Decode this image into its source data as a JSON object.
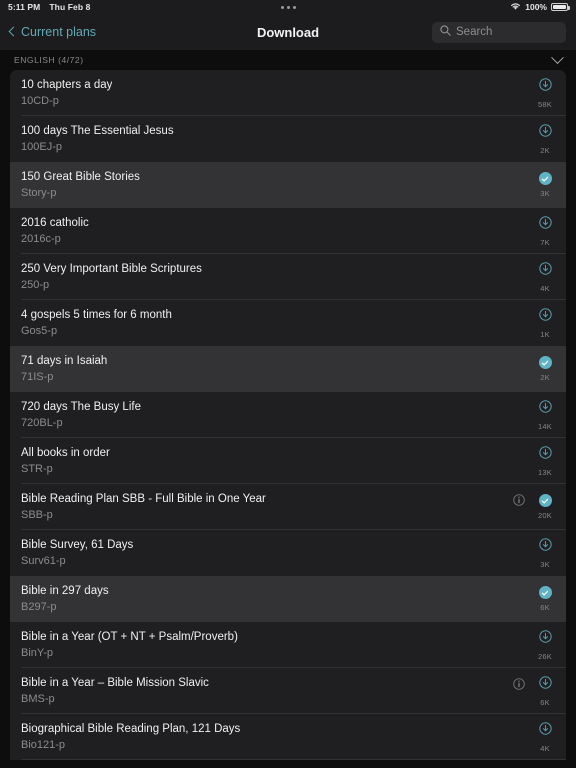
{
  "status_bar": {
    "time": "5:11 PM",
    "date": "Thu Feb 8",
    "menu_icon": "three-dots-icon",
    "wifi_icon": "wifi-icon",
    "battery_percent": "100%",
    "battery_icon": "battery-full-icon"
  },
  "nav_bar": {
    "back_icon": "chevron-left-icon",
    "back_label": "Current plans",
    "title": "Download",
    "search": {
      "icon": "search-icon",
      "value": "",
      "placeholder": "Search"
    }
  },
  "section": {
    "title": "ENGLISH (4/72)",
    "collapse_icon": "chevron-down-icon"
  },
  "colors": {
    "accent": "#62a8b4",
    "check_fill": "#5fb3c4",
    "row_bg": "#1f1f21",
    "row_bg_selected": "#333335",
    "page_bg": "#0d0d0d",
    "bar_bg": "#1c1c1e"
  },
  "plans": [
    {
      "title": "10 chapters a day",
      "code": "10CD-p",
      "size": "58K",
      "action": "download",
      "info": false,
      "selected": false
    },
    {
      "title": "100 days The Essential Jesus",
      "code": "100EJ-p",
      "size": "2K",
      "action": "download",
      "info": false,
      "selected": false
    },
    {
      "title": "150 Great Bible Stories",
      "code": "Story-p",
      "size": "3K",
      "action": "check",
      "info": false,
      "selected": true
    },
    {
      "title": "2016 catholic",
      "code": "2016c-p",
      "size": "7K",
      "action": "download",
      "info": false,
      "selected": false
    },
    {
      "title": "250 Very Important Bible Scriptures",
      "code": "250-p",
      "size": "4K",
      "action": "download",
      "info": false,
      "selected": false
    },
    {
      "title": "4 gospels 5 times for 6 month",
      "code": "Gos5-p",
      "size": "1K",
      "action": "download",
      "info": false,
      "selected": false
    },
    {
      "title": "71 days in Isaiah",
      "code": "71IS-p",
      "size": "2K",
      "action": "check",
      "info": false,
      "selected": true
    },
    {
      "title": "720 days The Busy Life",
      "code": "720BL-p",
      "size": "14K",
      "action": "download",
      "info": false,
      "selected": false
    },
    {
      "title": "All books in order",
      "code": "STR-p",
      "size": "13K",
      "action": "download",
      "info": false,
      "selected": false
    },
    {
      "title": "Bible Reading Plan SBB - Full Bible in One Year",
      "code": "SBB-p",
      "size": "20K",
      "action": "check",
      "info": true,
      "selected": false
    },
    {
      "title": "Bible Survey, 61 Days",
      "code": "Surv61-p",
      "size": "3K",
      "action": "download",
      "info": false,
      "selected": false
    },
    {
      "title": "Bible in 297 days",
      "code": "B297-p",
      "size": "6K",
      "action": "check",
      "info": false,
      "selected": true
    },
    {
      "title": "Bible in a Year (OT + NT + Psalm/Proverb)",
      "code": "BinY-p",
      "size": "26K",
      "action": "download",
      "info": false,
      "selected": false
    },
    {
      "title": "Bible in a Year – Bible Mission Slavic",
      "code": "BMS-p",
      "size": "6K",
      "action": "download",
      "info": true,
      "selected": false
    },
    {
      "title": "Biographical Bible Reading Plan, 121 Days",
      "code": "Bio121-p",
      "size": "4K",
      "action": "download",
      "info": false,
      "selected": false
    }
  ]
}
